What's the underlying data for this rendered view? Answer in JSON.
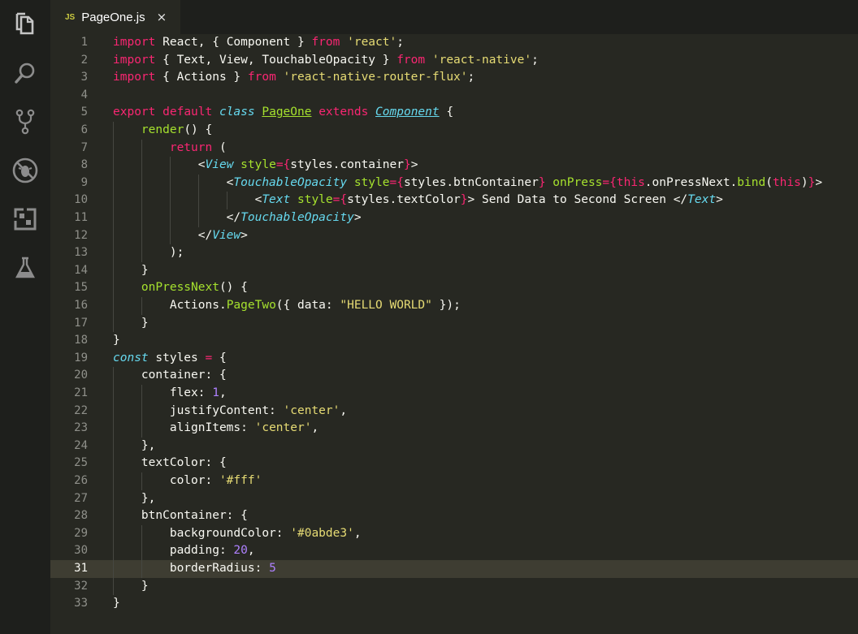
{
  "tab": {
    "lang": "JS",
    "filename": "PageOne.js",
    "close": "×"
  },
  "activity_icons": [
    "explorer-icon",
    "search-icon",
    "source-control-icon",
    "debug-icon",
    "extensions-icon",
    "test-flask-icon"
  ],
  "active_line": 31,
  "colors": {
    "keyword": "#f92672",
    "string": "#e6db74",
    "number": "#ae81ff",
    "function": "#a6e22e",
    "type": "#66d9ef",
    "text": "#f8f8f2",
    "background": "#272822"
  },
  "lines": [
    [
      [
        "import",
        "k"
      ],
      [
        " React, { Component } ",
        ""
      ],
      [
        "from",
        "k"
      ],
      [
        " ",
        ""
      ],
      [
        "'react'",
        "s"
      ],
      [
        ";",
        ""
      ]
    ],
    [
      [
        "import",
        "k"
      ],
      [
        " { Text, View, TouchableOpacity } ",
        ""
      ],
      [
        "from",
        "k"
      ],
      [
        " ",
        ""
      ],
      [
        "'react-native'",
        "s"
      ],
      [
        ";",
        ""
      ]
    ],
    [
      [
        "import",
        "k"
      ],
      [
        " { Actions } ",
        ""
      ],
      [
        "from",
        "k"
      ],
      [
        " ",
        ""
      ],
      [
        "'react-native-router-flux'",
        "s"
      ],
      [
        ";",
        ""
      ]
    ],
    [],
    [
      [
        "export",
        "k"
      ],
      [
        " ",
        ""
      ],
      [
        "default",
        "k"
      ],
      [
        " ",
        ""
      ],
      [
        "class",
        "i"
      ],
      [
        " ",
        ""
      ],
      [
        "PageOne",
        "f u"
      ],
      [
        " ",
        ""
      ],
      [
        "extends",
        "k"
      ],
      [
        " ",
        ""
      ],
      [
        "Component",
        "f i u"
      ],
      [
        " {",
        ""
      ]
    ],
    [
      [
        "    ",
        ""
      ],
      [
        "render",
        "f"
      ],
      [
        "() {",
        ""
      ]
    ],
    [
      [
        "        ",
        ""
      ],
      [
        "return",
        "k"
      ],
      [
        " (",
        ""
      ]
    ],
    [
      [
        "            <",
        ""
      ],
      [
        "View",
        "i"
      ],
      [
        " ",
        ""
      ],
      [
        "style",
        "f"
      ],
      [
        "=",
        "k"
      ],
      [
        "{",
        "k"
      ],
      [
        "styles.container",
        ""
      ],
      [
        "}",
        "k"
      ],
      [
        ">",
        ""
      ]
    ],
    [
      [
        "                <",
        ""
      ],
      [
        "TouchableOpacity",
        "i"
      ],
      [
        " ",
        ""
      ],
      [
        "style",
        "f"
      ],
      [
        "=",
        "k"
      ],
      [
        "{",
        "k"
      ],
      [
        "styles.btnContainer",
        ""
      ],
      [
        "}",
        "k"
      ],
      [
        " ",
        ""
      ],
      [
        "onPress",
        "f"
      ],
      [
        "=",
        "k"
      ],
      [
        "{",
        "k"
      ],
      [
        "this",
        "k"
      ],
      [
        ".onPressNext.",
        ""
      ],
      [
        "bind",
        "f"
      ],
      [
        "(",
        ""
      ],
      [
        "this",
        "k"
      ],
      [
        ")",
        ""
      ],
      [
        "}",
        "k"
      ],
      [
        ">",
        ""
      ]
    ],
    [
      [
        "                    <",
        ""
      ],
      [
        "Text",
        "i"
      ],
      [
        " ",
        ""
      ],
      [
        "style",
        "f"
      ],
      [
        "=",
        "k"
      ],
      [
        "{",
        "k"
      ],
      [
        "styles.textColor",
        ""
      ],
      [
        "}",
        "k"
      ],
      [
        "> Send Data to Second Screen </",
        ""
      ],
      [
        "Text",
        "i"
      ],
      [
        ">",
        ""
      ]
    ],
    [
      [
        "                </",
        ""
      ],
      [
        "TouchableOpacity",
        "i"
      ],
      [
        ">",
        ""
      ]
    ],
    [
      [
        "            </",
        ""
      ],
      [
        "View",
        "i"
      ],
      [
        ">",
        ""
      ]
    ],
    [
      [
        "        );",
        ""
      ]
    ],
    [
      [
        "    }",
        ""
      ]
    ],
    [
      [
        "    ",
        ""
      ],
      [
        "onPressNext",
        "f"
      ],
      [
        "() {",
        ""
      ]
    ],
    [
      [
        "        Actions.",
        ""
      ],
      [
        "PageTwo",
        "f"
      ],
      [
        "({ data: ",
        ""
      ],
      [
        "\"HELLO WORLD\"",
        "s"
      ],
      [
        " });",
        ""
      ]
    ],
    [
      [
        "    }",
        ""
      ]
    ],
    [
      [
        "}",
        ""
      ]
    ],
    [
      [
        "const",
        "i"
      ],
      [
        " styles ",
        ""
      ],
      [
        "=",
        "k"
      ],
      [
        " {",
        ""
      ]
    ],
    [
      [
        "    container: {",
        ""
      ]
    ],
    [
      [
        "        flex: ",
        ""
      ],
      [
        "1",
        "n"
      ],
      [
        ",",
        ""
      ]
    ],
    [
      [
        "        justifyContent: ",
        ""
      ],
      [
        "'center'",
        "s"
      ],
      [
        ",",
        ""
      ]
    ],
    [
      [
        "        alignItems: ",
        ""
      ],
      [
        "'center'",
        "s"
      ],
      [
        ",",
        ""
      ]
    ],
    [
      [
        "    },",
        ""
      ]
    ],
    [
      [
        "    textColor: {",
        ""
      ]
    ],
    [
      [
        "        color: ",
        ""
      ],
      [
        "'#fff'",
        "s"
      ]
    ],
    [
      [
        "    },",
        ""
      ]
    ],
    [
      [
        "    btnContainer: {",
        ""
      ]
    ],
    [
      [
        "        backgroundColor: ",
        ""
      ],
      [
        "'#0abde3'",
        "s"
      ],
      [
        ",",
        ""
      ]
    ],
    [
      [
        "        padding: ",
        ""
      ],
      [
        "20",
        "n"
      ],
      [
        ",",
        ""
      ]
    ],
    [
      [
        "        borderRadius: ",
        ""
      ],
      [
        "5",
        "n"
      ]
    ],
    [
      [
        "    }",
        ""
      ]
    ],
    [
      [
        "}",
        ""
      ]
    ]
  ]
}
